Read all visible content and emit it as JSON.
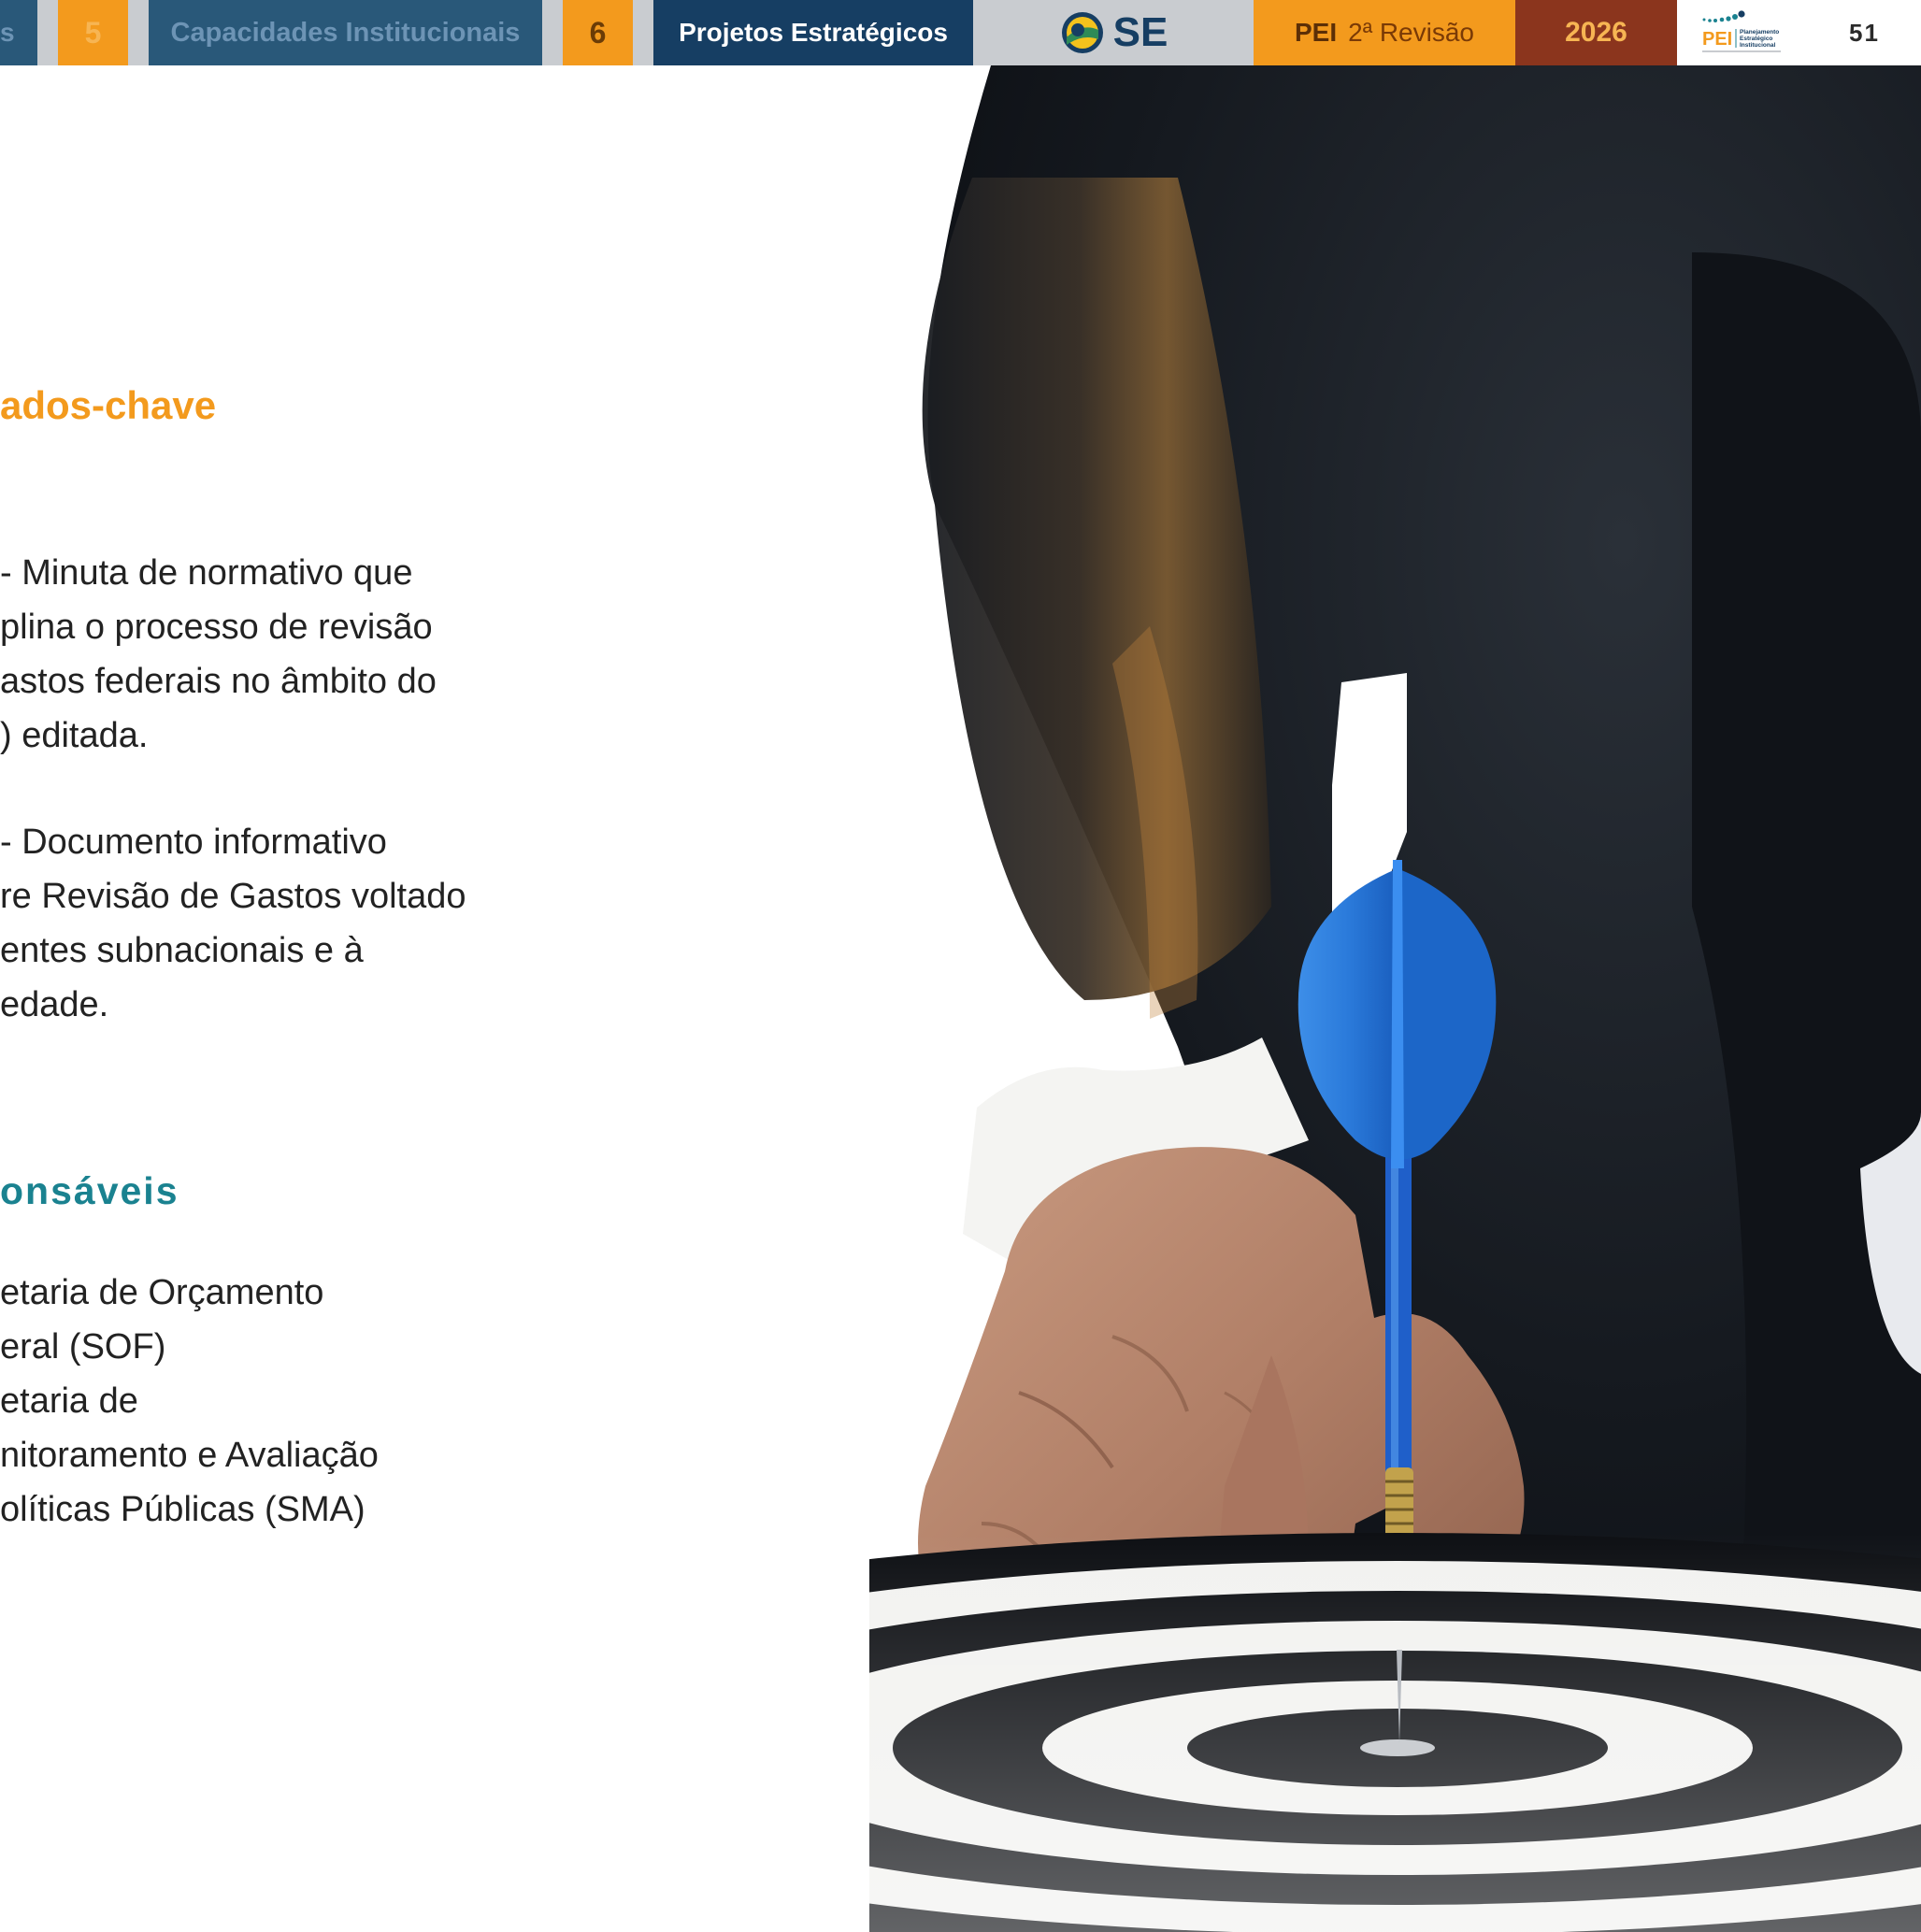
{
  "header": {
    "nav_fragment": "s",
    "section5_number": "5",
    "section5_label": "Capacidades Institucionais",
    "section6_number": "6",
    "section6_label": "Projetos Estratégicos",
    "org": "SE",
    "doc_name": "PEI",
    "revision": "2ª Revisão",
    "year": "2026",
    "logo_text": "PEI",
    "logo_subtitle": [
      "Planejamento",
      "Estratégico",
      "Institucional"
    ],
    "page_number": "51"
  },
  "results": {
    "heading": "ados-chave",
    "item1_lines": [
      "- Minuta de normativo que",
      "plina o processo de revisão",
      "astos federais no âmbito do",
      ") editada."
    ],
    "item2_lines": [
      "- Documento informativo",
      "re Revisão de Gastos voltado",
      "entes subnacionais e à",
      "edade."
    ]
  },
  "responsible": {
    "heading": "onsáveis",
    "lines": [
      "etaria de Orçamento",
      "eral (SOF)",
      "etaria de",
      "nitoramento e Avaliação",
      "olíticas Públicas (SMA)"
    ]
  },
  "colors": {
    "nav_blue": "#2e5f88",
    "nav_dark_blue": "#163e63",
    "orange": "#f39a1d",
    "brown": "#8b351d",
    "teal": "#1a8290",
    "gray": "#c9ccd0"
  }
}
